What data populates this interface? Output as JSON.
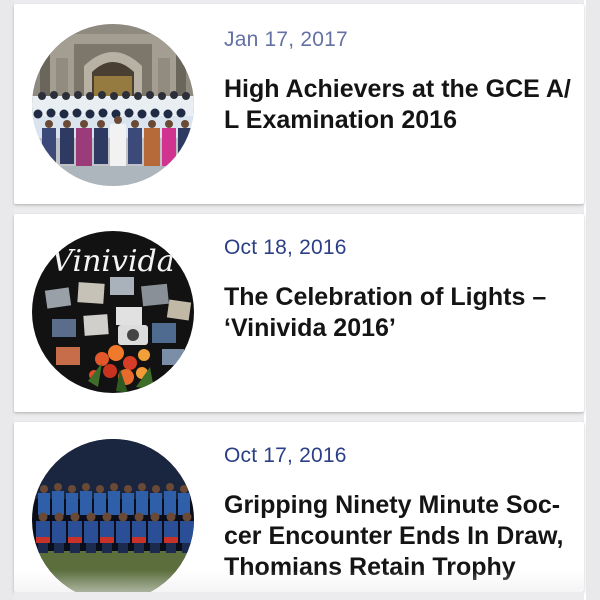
{
  "feed": {
    "articles": [
      {
        "date": "Jan 17, 2017",
        "title_lines": [
          "High Achievers at the GCE A/",
          "L Examination 2016"
        ],
        "thumbnail": "group-photo-building"
      },
      {
        "date": "Oct 18, 2016",
        "title_lines": [
          "The Celebration of Lights –",
          "‘Vinivida 2016’"
        ],
        "thumbnail": "vinivida-display-board",
        "thumbnail_text": "Vinivida"
      },
      {
        "date": "Oct 17, 2016",
        "title_lines": [
          "Gripping Ninety Minute Soc-",
          "cer Encounter Ends In Draw,",
          "Thomians Retain Trophy"
        ],
        "thumbnail": "soccer-team-night"
      }
    ]
  },
  "colors": {
    "date_text": "#2b3f87",
    "title_text": "#141414",
    "card_bg": "#ffffff",
    "feed_bg": "#ececee"
  }
}
